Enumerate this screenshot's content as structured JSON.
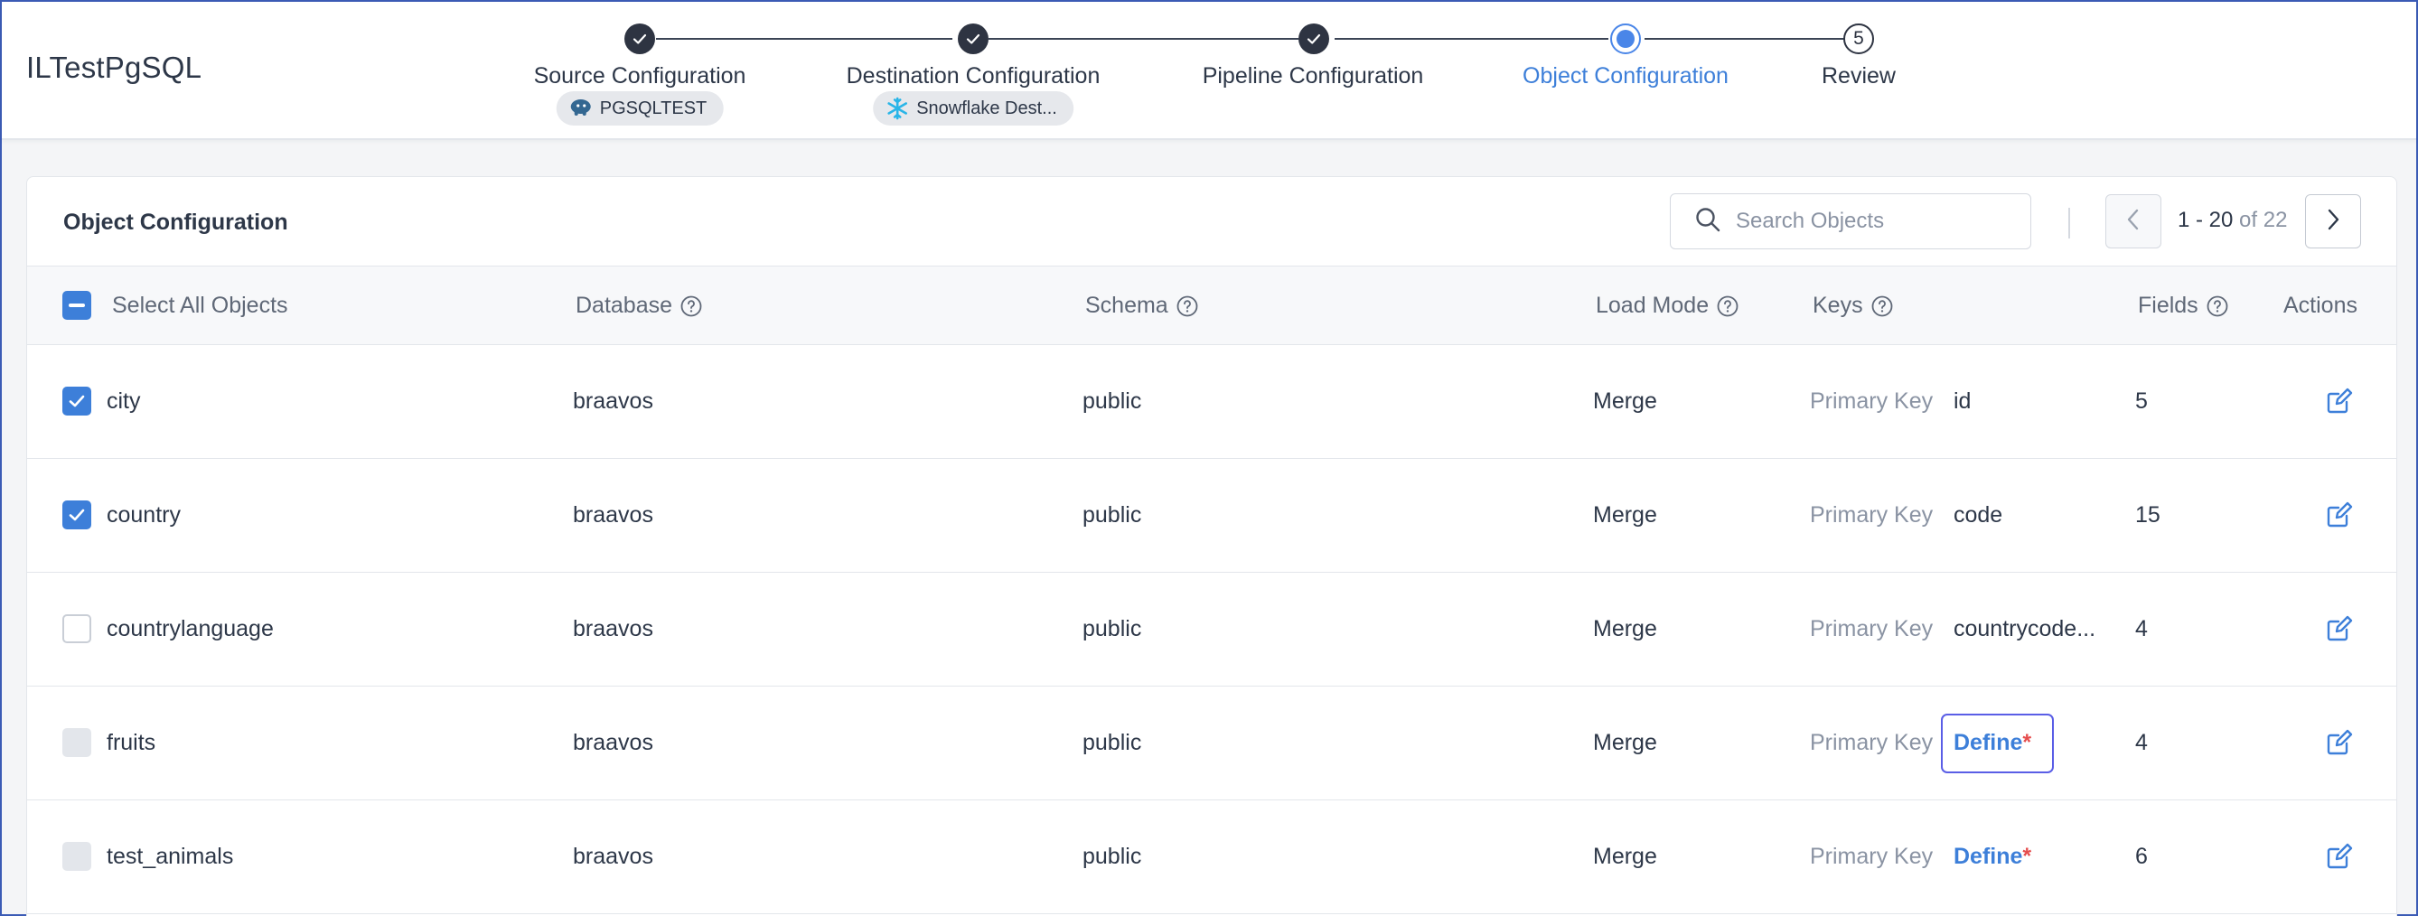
{
  "app": {
    "title": "ILTestPgSQL"
  },
  "stepper": {
    "steps": [
      {
        "label": "Source Configuration",
        "status": "done",
        "chip": "PGSQLTEST"
      },
      {
        "label": "Destination Configuration",
        "status": "done",
        "chip": "Snowflake Dest..."
      },
      {
        "label": "Pipeline Configuration",
        "status": "done"
      },
      {
        "label": "Object Configuration",
        "status": "active"
      },
      {
        "label": "Review",
        "status": "todo",
        "number": "5"
      }
    ]
  },
  "panel": {
    "title": "Object Configuration",
    "search_placeholder": "Search Objects",
    "pagination": {
      "range": "1 - 20",
      "of_total": "of 22"
    }
  },
  "table": {
    "headers": {
      "select_all": "Select All Objects",
      "database": "Database",
      "schema": "Schema",
      "load_mode": "Load Mode",
      "keys": "Keys",
      "fields": "Fields",
      "actions": "Actions"
    },
    "rows": [
      {
        "name": "city",
        "checkbox": "checked",
        "database": "braavos",
        "schema": "public",
        "load_mode": "Merge",
        "key_type": "Primary Key",
        "key_value": "id",
        "fields": "5"
      },
      {
        "name": "country",
        "checkbox": "checked",
        "database": "braavos",
        "schema": "public",
        "load_mode": "Merge",
        "key_type": "Primary Key",
        "key_value": "code",
        "fields": "15"
      },
      {
        "name": "countrylanguage",
        "checkbox": "unchecked",
        "database": "braavos",
        "schema": "public",
        "load_mode": "Merge",
        "key_type": "Primary Key",
        "key_value": "countrycode...",
        "fields": "4"
      },
      {
        "name": "fruits",
        "checkbox": "disabled",
        "database": "braavos",
        "schema": "public",
        "load_mode": "Merge",
        "key_type": "Primary Key",
        "define_label": "Define",
        "define_required": "*",
        "fields": "4"
      },
      {
        "name": "test_animals",
        "checkbox": "disabled",
        "database": "braavos",
        "schema": "public",
        "load_mode": "Merge",
        "key_type": "Primary Key",
        "define_label": "Define",
        "define_required": "*",
        "fields": "6"
      }
    ]
  },
  "colors": {
    "accent": "#3d7fd9",
    "required": "#e54d4d",
    "focus_ring": "#5a5ee6"
  }
}
